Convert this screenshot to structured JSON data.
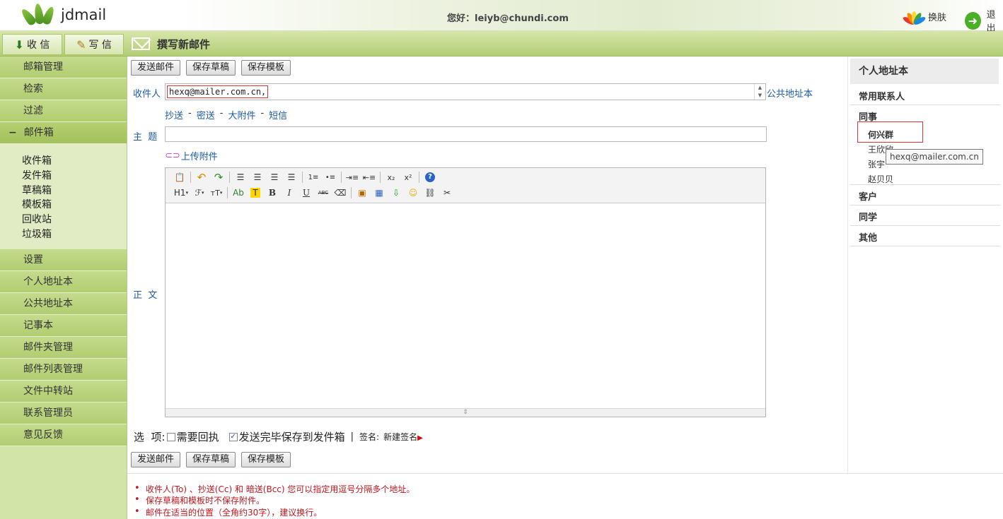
{
  "header": {
    "logo_text": "jdmail",
    "greeting": "您好：leiyb@chundi.com",
    "skin_label": "换肤",
    "logout_label": "退出"
  },
  "topbar": {
    "receive_label": "收 信",
    "write_label": "写 信",
    "page_title": "撰写新邮件"
  },
  "sidebar": {
    "items_top": [
      "邮箱管理",
      "检索",
      "过滤"
    ],
    "mailbox_label": "邮件箱",
    "mailbox_toggle": "−",
    "folders": [
      "收件箱",
      "发件箱",
      "草稿箱",
      "模板箱",
      "回收站",
      "垃圾箱"
    ],
    "items_bottom": [
      "设置",
      "个人地址本",
      "公共地址本",
      "记事本",
      "邮件夹管理",
      "邮件列表管理",
      "文件中转站",
      "联系管理员",
      "意见反馈"
    ]
  },
  "compose": {
    "send_label": "发送邮件",
    "save_draft_label": "保存草稿",
    "save_template_label": "保存模板",
    "to_label": "收件人",
    "to_value": "hexq@mailer.com.cn,",
    "public_addressbook_link": "公共地址本",
    "cc_link": "抄送",
    "bcc_link": "密送",
    "big_attach_link": "大附件",
    "sms_link": "短信",
    "link_sep": "-",
    "subject_label": "主  题",
    "subject_value": "",
    "upload_link": "上传附件",
    "body_label": "正  文",
    "options_label": "选  项:",
    "receipt_label": "需要回执",
    "receipt_checked": false,
    "save_sent_label": "发送完毕保存到发件箱",
    "save_sent_checked": true,
    "option_sep": "|",
    "signature_label": "签名:",
    "signature_value": "新建签名"
  },
  "toolbar": {
    "row1": [
      "paste-icon",
      "undo-icon",
      "redo-icon",
      "align-left-icon",
      "align-center-icon",
      "align-right-icon",
      "justify-icon",
      "ordered-list-icon",
      "unordered-list-icon",
      "indent-icon",
      "outdent-icon",
      "subscript-icon",
      "superscript-icon",
      "help-icon"
    ],
    "heading": "H1",
    "font": "ℱ",
    "size": "тT",
    "fore_color": "Ab",
    "back_color": "T",
    "bold": "B",
    "italic": "I",
    "underline": "U",
    "strike": "ABC"
  },
  "addressbook": {
    "title": "个人地址本",
    "frequent": "常用联系人",
    "colleagues": "同事",
    "contacts": [
      "何兴群",
      "王欣欣",
      "张宇",
      "赵贝贝"
    ],
    "tooltip": "hexq@mailer.com.cn",
    "clients": "客户",
    "classmates": "同学",
    "others": "其他"
  },
  "tips": [
    "收件人(To) 、抄送(Cc) 和 暗送(Bcc) 您可以指定用逗号分隔多个地址。",
    "保存草稿和模板时不保存附件。",
    "邮件在适当的位置（全角约30字），建议换行。"
  ],
  "colors": {
    "sidebar_bg": "#d3e4a9",
    "nav_item": "#b1cd71",
    "link_blue": "#1d5ba6",
    "tip_red": "#c0161d",
    "highlight_red": "#dd3333"
  }
}
